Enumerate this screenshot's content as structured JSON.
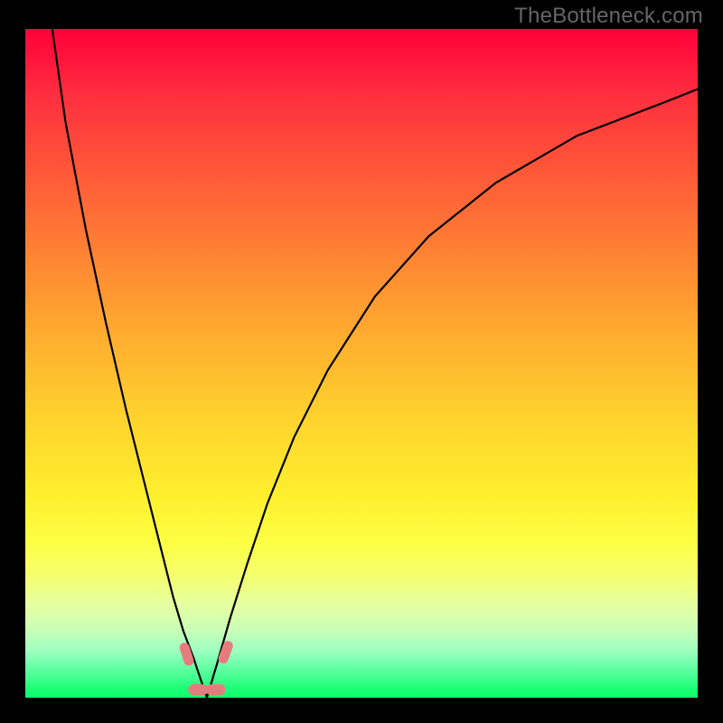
{
  "domain": "Chart",
  "watermark": "TheBottleneck.com",
  "colors": {
    "background": "#000000",
    "gradient_top": "#ff003a",
    "gradient_mid": "#ffd22d",
    "gradient_bottom": "#0aff6b",
    "curve_stroke": "#000000",
    "marker_fill": "#e77c7e"
  },
  "chart_data": {
    "type": "line",
    "title": "",
    "xlabel": "",
    "ylabel": "",
    "xlim": [
      0,
      100
    ],
    "ylim": [
      0,
      100
    ],
    "note": "Axes have no numeric labels; values are percent of plot area (0 = left/bottom, 100 = right/top). The two curves form a V shape touching the bottom near x≈27.",
    "series": [
      {
        "name": "left-branch",
        "x": [
          4,
          6,
          9,
          12,
          15,
          18,
          20,
          22,
          23.5,
          25,
          26,
          27
        ],
        "y": [
          100,
          86,
          70,
          56,
          43,
          31,
          23,
          15,
          10,
          6,
          3,
          0
        ]
      },
      {
        "name": "right-branch",
        "x": [
          27,
          28.5,
          30.5,
          33,
          36,
          40,
          45,
          52,
          60,
          70,
          82,
          95,
          100
        ],
        "y": [
          0,
          5,
          12,
          20,
          29,
          39,
          49,
          60,
          69,
          77,
          84,
          89,
          91
        ]
      }
    ],
    "markers": [
      {
        "label": "notch-left",
        "x": 24.0,
        "y": 6.5
      },
      {
        "label": "notch-right",
        "x": 29.8,
        "y": 6.8
      },
      {
        "label": "bottom-pill-left",
        "x": 25.7,
        "y": 1.2
      },
      {
        "label": "bottom-pill-right",
        "x": 28.3,
        "y": 1.2
      }
    ]
  }
}
